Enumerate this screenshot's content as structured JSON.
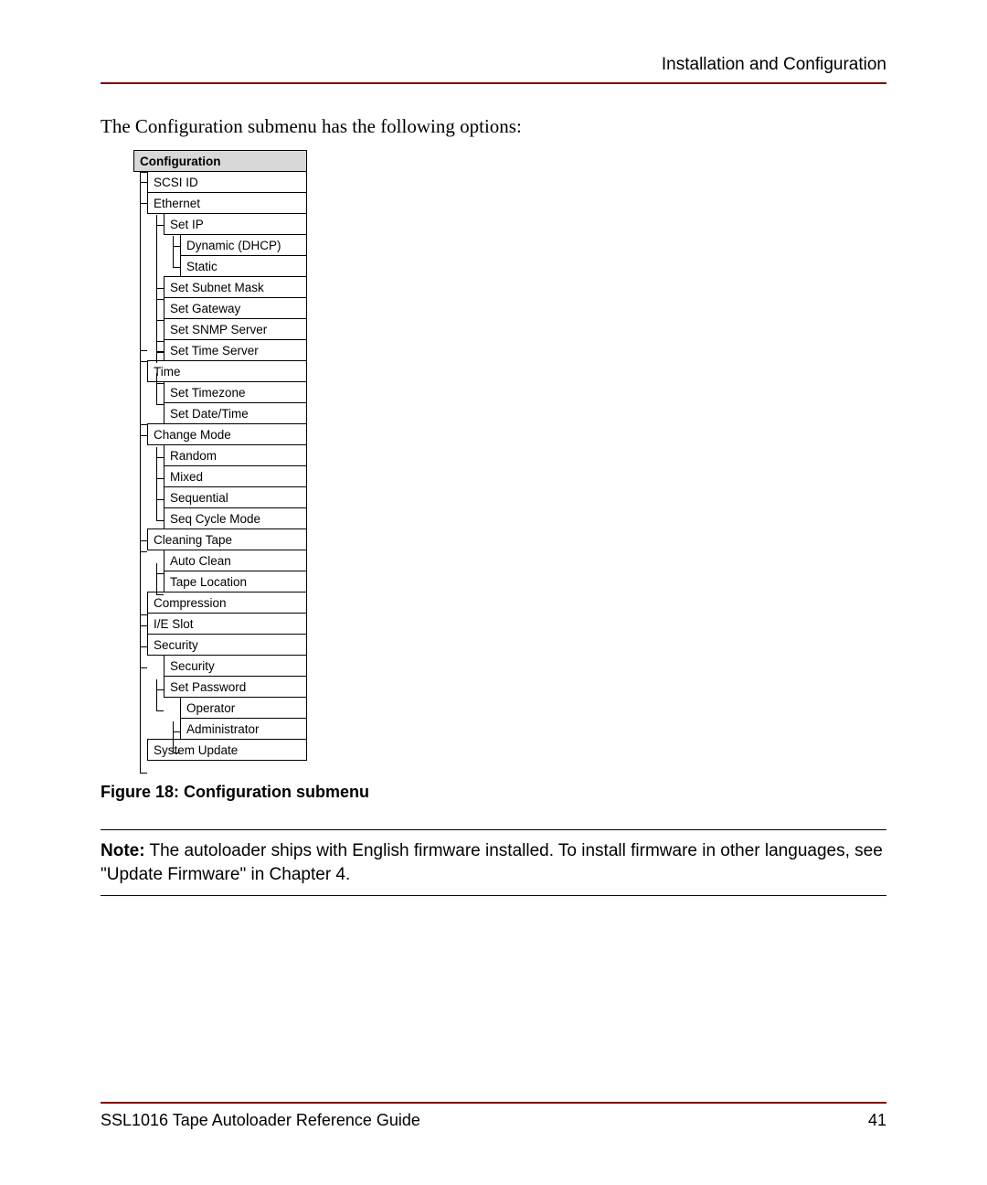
{
  "header": {
    "section": "Installation and Configuration"
  },
  "intro": "The Configuration submenu has the following options:",
  "menu": {
    "title": "Configuration",
    "scsi_id": "SCSI ID",
    "ethernet": "Ethernet",
    "set_ip": "Set IP",
    "dhcp": "Dynamic (DHCP)",
    "static": "Static",
    "subnet": "Set Subnet Mask",
    "gateway": "Set Gateway",
    "snmp": "Set SNMP Server",
    "timeserver": "Set Time Server",
    "time": "Time",
    "tz": "Set Timezone",
    "datetime": "Set Date/Time",
    "change_mode": "Change Mode",
    "random": "Random",
    "mixed": "Mixed",
    "sequential": "Sequential",
    "seq_cycle": "Seq Cycle Mode",
    "cleaning": "Cleaning Tape",
    "auto_clean": "Auto Clean",
    "tape_loc": "Tape Location",
    "compression": "Compression",
    "ie_slot": "I/E Slot",
    "security": "Security",
    "security_sub": "Security",
    "set_password": "Set Password",
    "operator": "Operator",
    "admin": "Administrator",
    "sys_update": "System Update"
  },
  "figure_caption": "Figure 18:  Configuration submenu",
  "note": {
    "label": "Note:",
    "text": "The autoloader ships with English firmware installed. To install firmware in other languages, see \"Update Firmware\" in Chapter 4."
  },
  "footer": {
    "doc": "SSL1016 Tape Autoloader Reference Guide",
    "page": "41"
  }
}
